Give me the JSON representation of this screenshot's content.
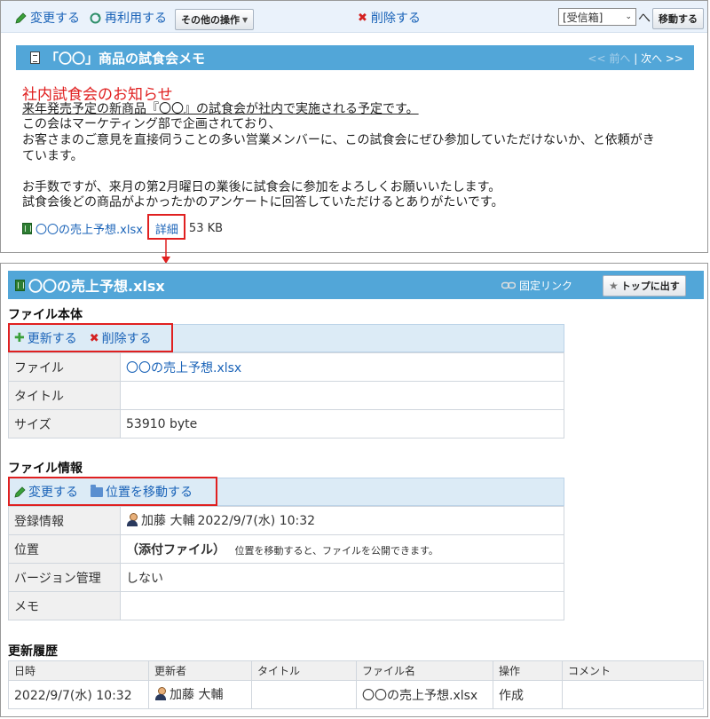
{
  "toolbar": {
    "edit": "変更する",
    "reuse": "再利用する",
    "other_ops": "その他の操作",
    "delete": "削除する",
    "folder_select": "[受信箱]",
    "to": "へ",
    "move": "移動する"
  },
  "memo": {
    "title": "「〇〇」商品の試食会メモ",
    "prev": "<< 前へ",
    "sep": "|",
    "next": "次へ >>",
    "heading": "社内試食会のお知らせ",
    "lines": [
      "来年発売予定の新商品『〇〇』の試食会が社内で実施される予定です。",
      "この会はマーケティング部で企画されており、",
      "お客さまのご意見を直接伺うことの多い営業メンバーに、この試食会にぜひ参加していただけないか、と依頼がき",
      "ています。",
      "お手数ですが、来月の第2月曜日の業後に試食会に参加をよろしくお願いいたします。",
      "試食会後どの商品がよかったかのアンケートに回答していただけるとありがたいです。"
    ],
    "attachment_name": "〇〇の売上予想.xlsx",
    "detail": "詳細",
    "attachment_size": "53 KB"
  },
  "file_detail": {
    "title": "〇〇の売上予想.xlsx",
    "permalink": "固定リンク",
    "top": "トップに出す",
    "body_section": "ファイル本体",
    "update": "更新する",
    "delete": "削除する",
    "rows": {
      "file_label": "ファイル",
      "file_value": "〇〇の売上予想.xlsx",
      "title_label": "タイトル",
      "title_value": "",
      "size_label": "サイズ",
      "size_value": "53910 byte"
    },
    "info_section": "ファイル情報",
    "edit": "変更する",
    "move_location": "位置を移動する",
    "info_rows": {
      "registered_label": "登録情報",
      "registered_user": "加藤 大輔",
      "registered_date": "2022/9/7(水) 10:32",
      "location_label": "位置",
      "location_value": "（添付ファイル）",
      "location_note": "位置を移動すると、ファイルを公開できます。",
      "version_label": "バージョン管理",
      "version_value": "しない",
      "memo_label": "メモ",
      "memo_value": ""
    },
    "history_section": "更新履歴",
    "history_headers": [
      "日時",
      "更新者",
      "タイトル",
      "ファイル名",
      "操作",
      "コメント"
    ],
    "history_rows": [
      {
        "datetime": "2022/9/7(水) 10:32",
        "user": "加藤 大輔",
        "title": "",
        "filename": "〇〇の売上予想.xlsx",
        "operation": "作成",
        "comment": ""
      }
    ]
  },
  "colors": {
    "titlebar": "#52a6d8",
    "link": "#1a63b8",
    "highlight": "#e02020",
    "heading": "#e02020"
  }
}
